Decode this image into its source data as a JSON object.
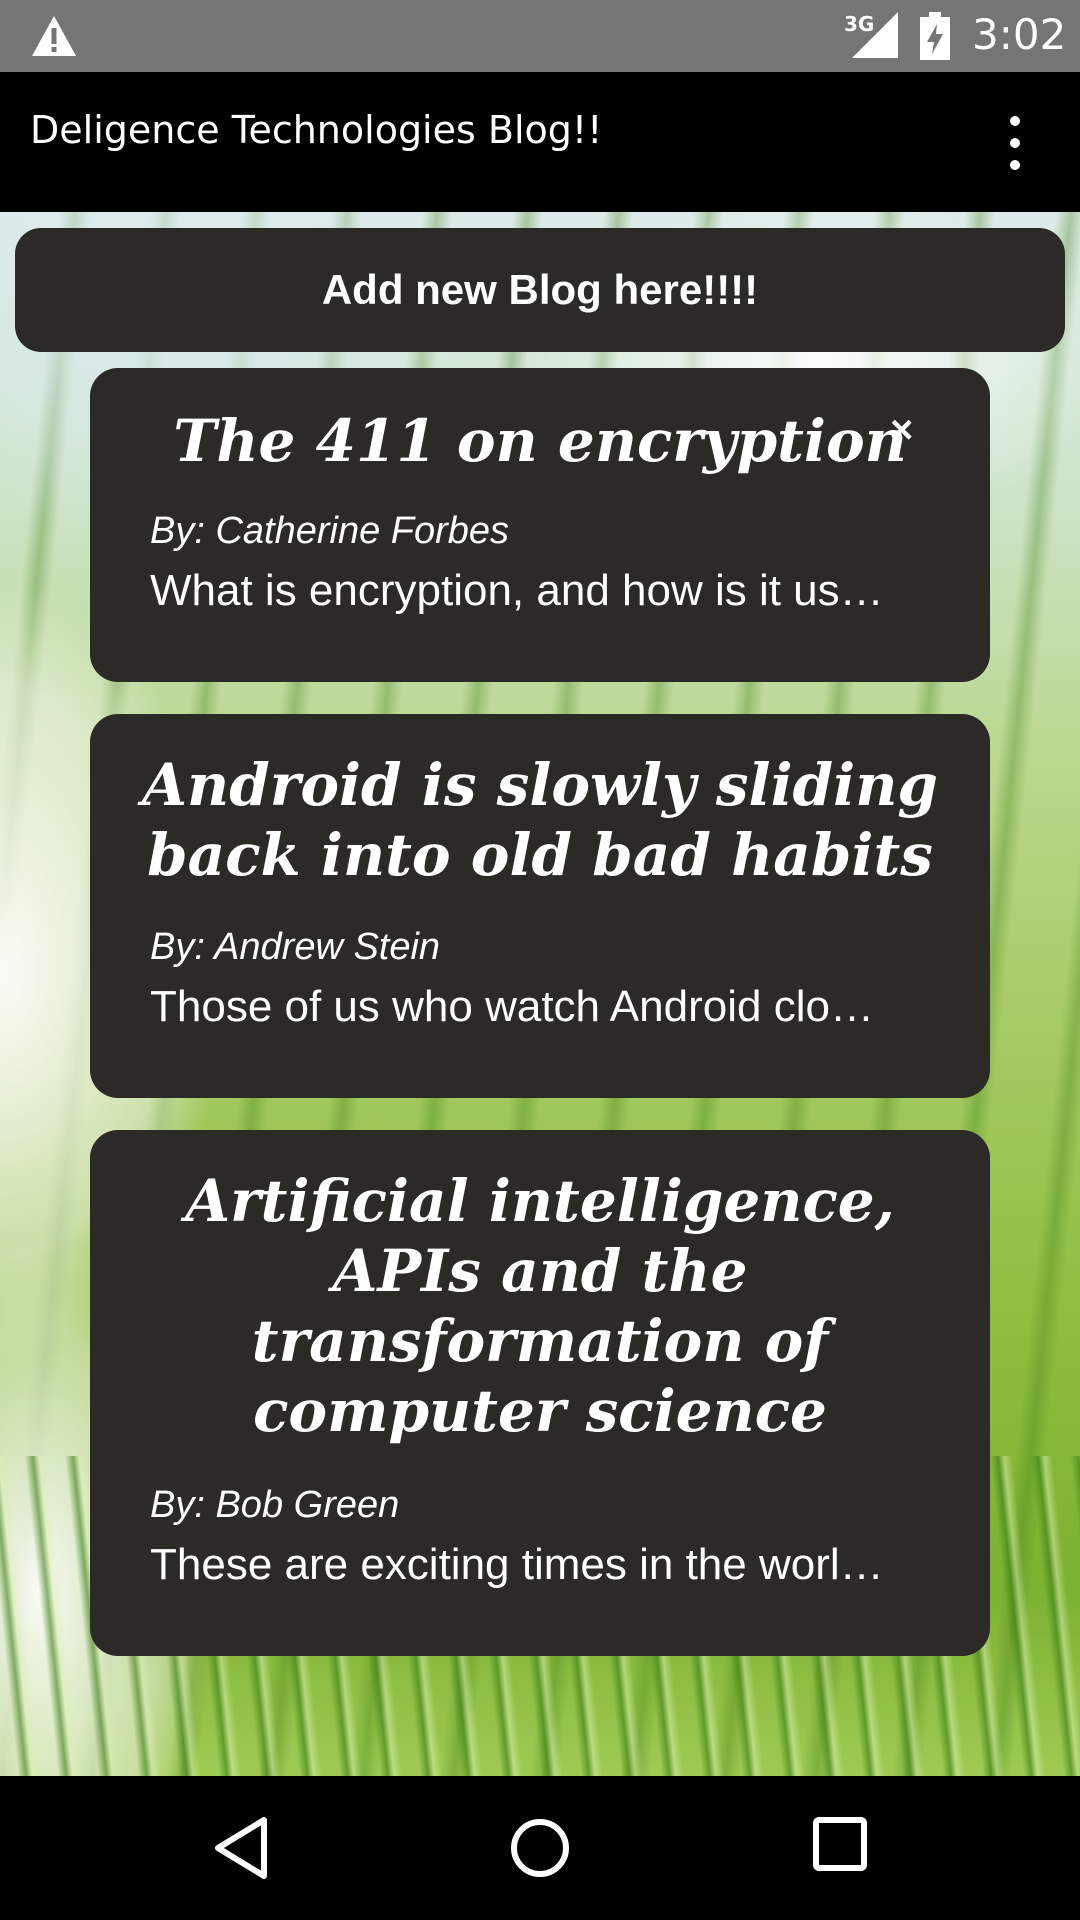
{
  "status_bar": {
    "network": "3G",
    "time": "3:02",
    "icons": [
      "warning-icon",
      "signal-icon",
      "battery-charging-icon"
    ]
  },
  "app_bar": {
    "title": "Deligence Technologies Blog!!",
    "menu_icon": "overflow-menu-icon"
  },
  "main": {
    "add_button_label": "Add new Blog here!!!!",
    "posts": [
      {
        "title": "The 411 on encryption",
        "author": "By: Catherine Forbes",
        "excerpt": "What is encryption, and how is it us…",
        "close_label": "×"
      },
      {
        "title": "Android is slowly sliding back into old bad habits",
        "author": "By: Andrew Stein",
        "excerpt": "Those of us who watch Android clo…"
      },
      {
        "title": "Artificial intelligence, APIs and the transformation of computer science",
        "author": "By: Bob Green",
        "excerpt": "These are exciting times in the worl…"
      }
    ]
  },
  "nav_bar": {
    "icons": [
      "back-icon",
      "home-icon",
      "recents-icon"
    ]
  }
}
